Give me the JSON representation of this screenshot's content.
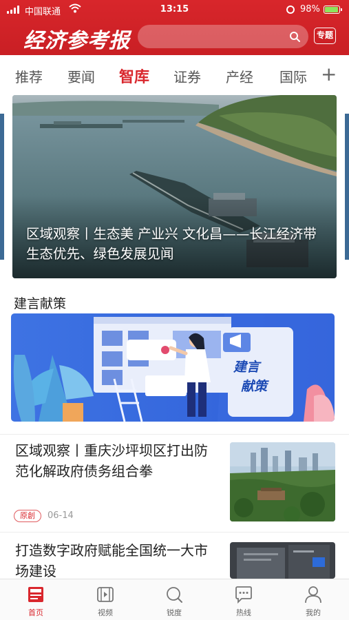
{
  "status_bar": {
    "carrier": "中国联通",
    "time": "13:15",
    "battery": "98%"
  },
  "header": {
    "logo": "经济参考报",
    "search_placeholder": "",
    "special_label": "专题"
  },
  "tabs": [
    {
      "label": "推荐",
      "active": false
    },
    {
      "label": "要闻",
      "active": false
    },
    {
      "label": "智库",
      "active": true
    },
    {
      "label": "证券",
      "active": false
    },
    {
      "label": "产经",
      "active": false
    },
    {
      "label": "国际",
      "active": false
    }
  ],
  "add_tab_label": "+",
  "hero": {
    "caption": "区域观察丨生态美 产业兴 文化昌——长江经济带生态优先、绿色发展见闻"
  },
  "section": {
    "title": "建言献策",
    "banner_label_line1": "建言",
    "banner_label_line2": "献策"
  },
  "articles": [
    {
      "title": "区域观察丨重庆沙坪坝区打出防范化解政府债务组合拳",
      "tag": "原創",
      "date": "06-14"
    },
    {
      "title": "打造数字政府赋能全国统一大市场建设"
    }
  ],
  "bottom_nav": [
    {
      "label": "首页",
      "icon": "news-icon",
      "active": true
    },
    {
      "label": "视频",
      "icon": "video-icon",
      "active": false
    },
    {
      "label": "锐度",
      "icon": "search-icon",
      "active": false
    },
    {
      "label": "热线",
      "icon": "chat-icon",
      "active": false
    },
    {
      "label": "我的",
      "icon": "user-icon",
      "active": false
    }
  ],
  "colors": {
    "brand_red": "#d9272d",
    "header_red": "#c91f24",
    "battery_green": "#8fe35c"
  }
}
